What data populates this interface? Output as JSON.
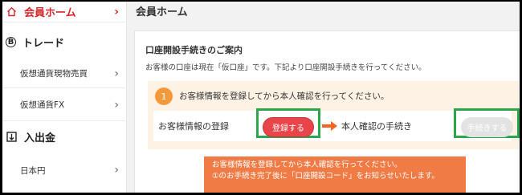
{
  "sidebar": {
    "items": [
      {
        "label": "会員ホーム",
        "icon": "home-icon",
        "level": "head",
        "active": true
      },
      {
        "label": "トレード",
        "icon": "bitcoin-icon",
        "level": "head",
        "active": false
      },
      {
        "label": "仮想通貨現物売買",
        "icon": "",
        "level": "sub",
        "active": false
      },
      {
        "label": "仮想通貨FX",
        "icon": "",
        "level": "sub",
        "active": false
      },
      {
        "label": "入出金",
        "icon": "deposit-icon",
        "level": "head",
        "active": false
      },
      {
        "label": "日本円",
        "icon": "",
        "level": "sub",
        "active": false
      }
    ],
    "chevron": "›"
  },
  "main": {
    "page_title": "会員ホーム",
    "card": {
      "title": "口座開設手続きのご案内",
      "desc": "お客様の口座は現在「仮口座」です。下記より口座開設手続きを行ってください。",
      "step": {
        "number": "1",
        "text": "お客様情報を登録してから本人確認を行ってください。",
        "register_label": "お客様情報の登録",
        "register_button": "登録する",
        "kyc_label": "本人確認の手続き",
        "procedure_button": "手続きする"
      },
      "notice": {
        "line1": "お客様情報を登録してから本人確認を行ってください。",
        "line2": "①のお手続き完了後に「口座開設コード」をお知らせいたします。"
      }
    }
  },
  "colors": {
    "accent_red": "#d9262a",
    "button_red": "#e8454a",
    "step_orange": "#f29a3b",
    "notice_orange": "#f17b45",
    "highlight_green": "#2ca64a",
    "disabled_gray": "#e3e3e3"
  }
}
